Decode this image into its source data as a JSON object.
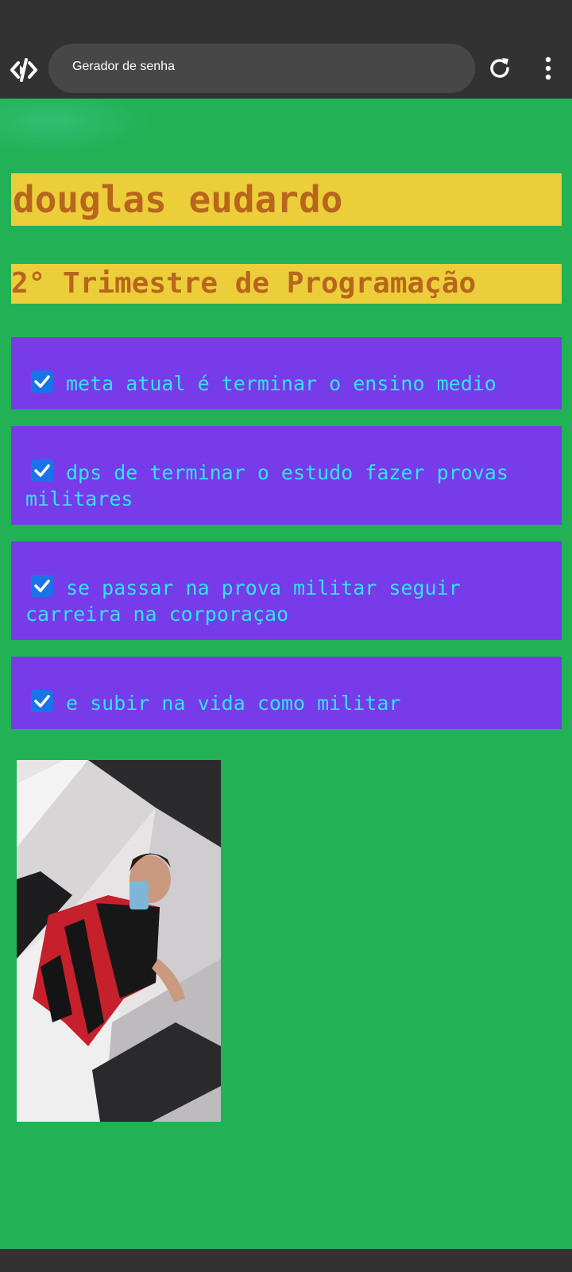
{
  "browser": {
    "url_title": "Gerador de senha",
    "icons": [
      "code-logo-icon",
      "reload-icon",
      "more-vert-icon"
    ]
  },
  "page": {
    "title": "douglas eudardo",
    "subtitle": "2° Trimestre de Programação",
    "goals": [
      {
        "label": "meta atual é terminar o ensino medio",
        "checked": true
      },
      {
        "label": "dps de terminar o estudo fazer provas militares",
        "checked": true
      },
      {
        "label": "se passar na prova militar seguir carreira na corporaçao",
        "checked": true
      },
      {
        "label": "e subir na vida como militar",
        "checked": true
      }
    ]
  },
  "colors": {
    "background": "#22b155",
    "title_bg": "#ecce3a",
    "title_text": "#b8651d",
    "goal_bg": "#773be9",
    "goal_text": "#2ee6f0",
    "chrome": "#323232"
  }
}
